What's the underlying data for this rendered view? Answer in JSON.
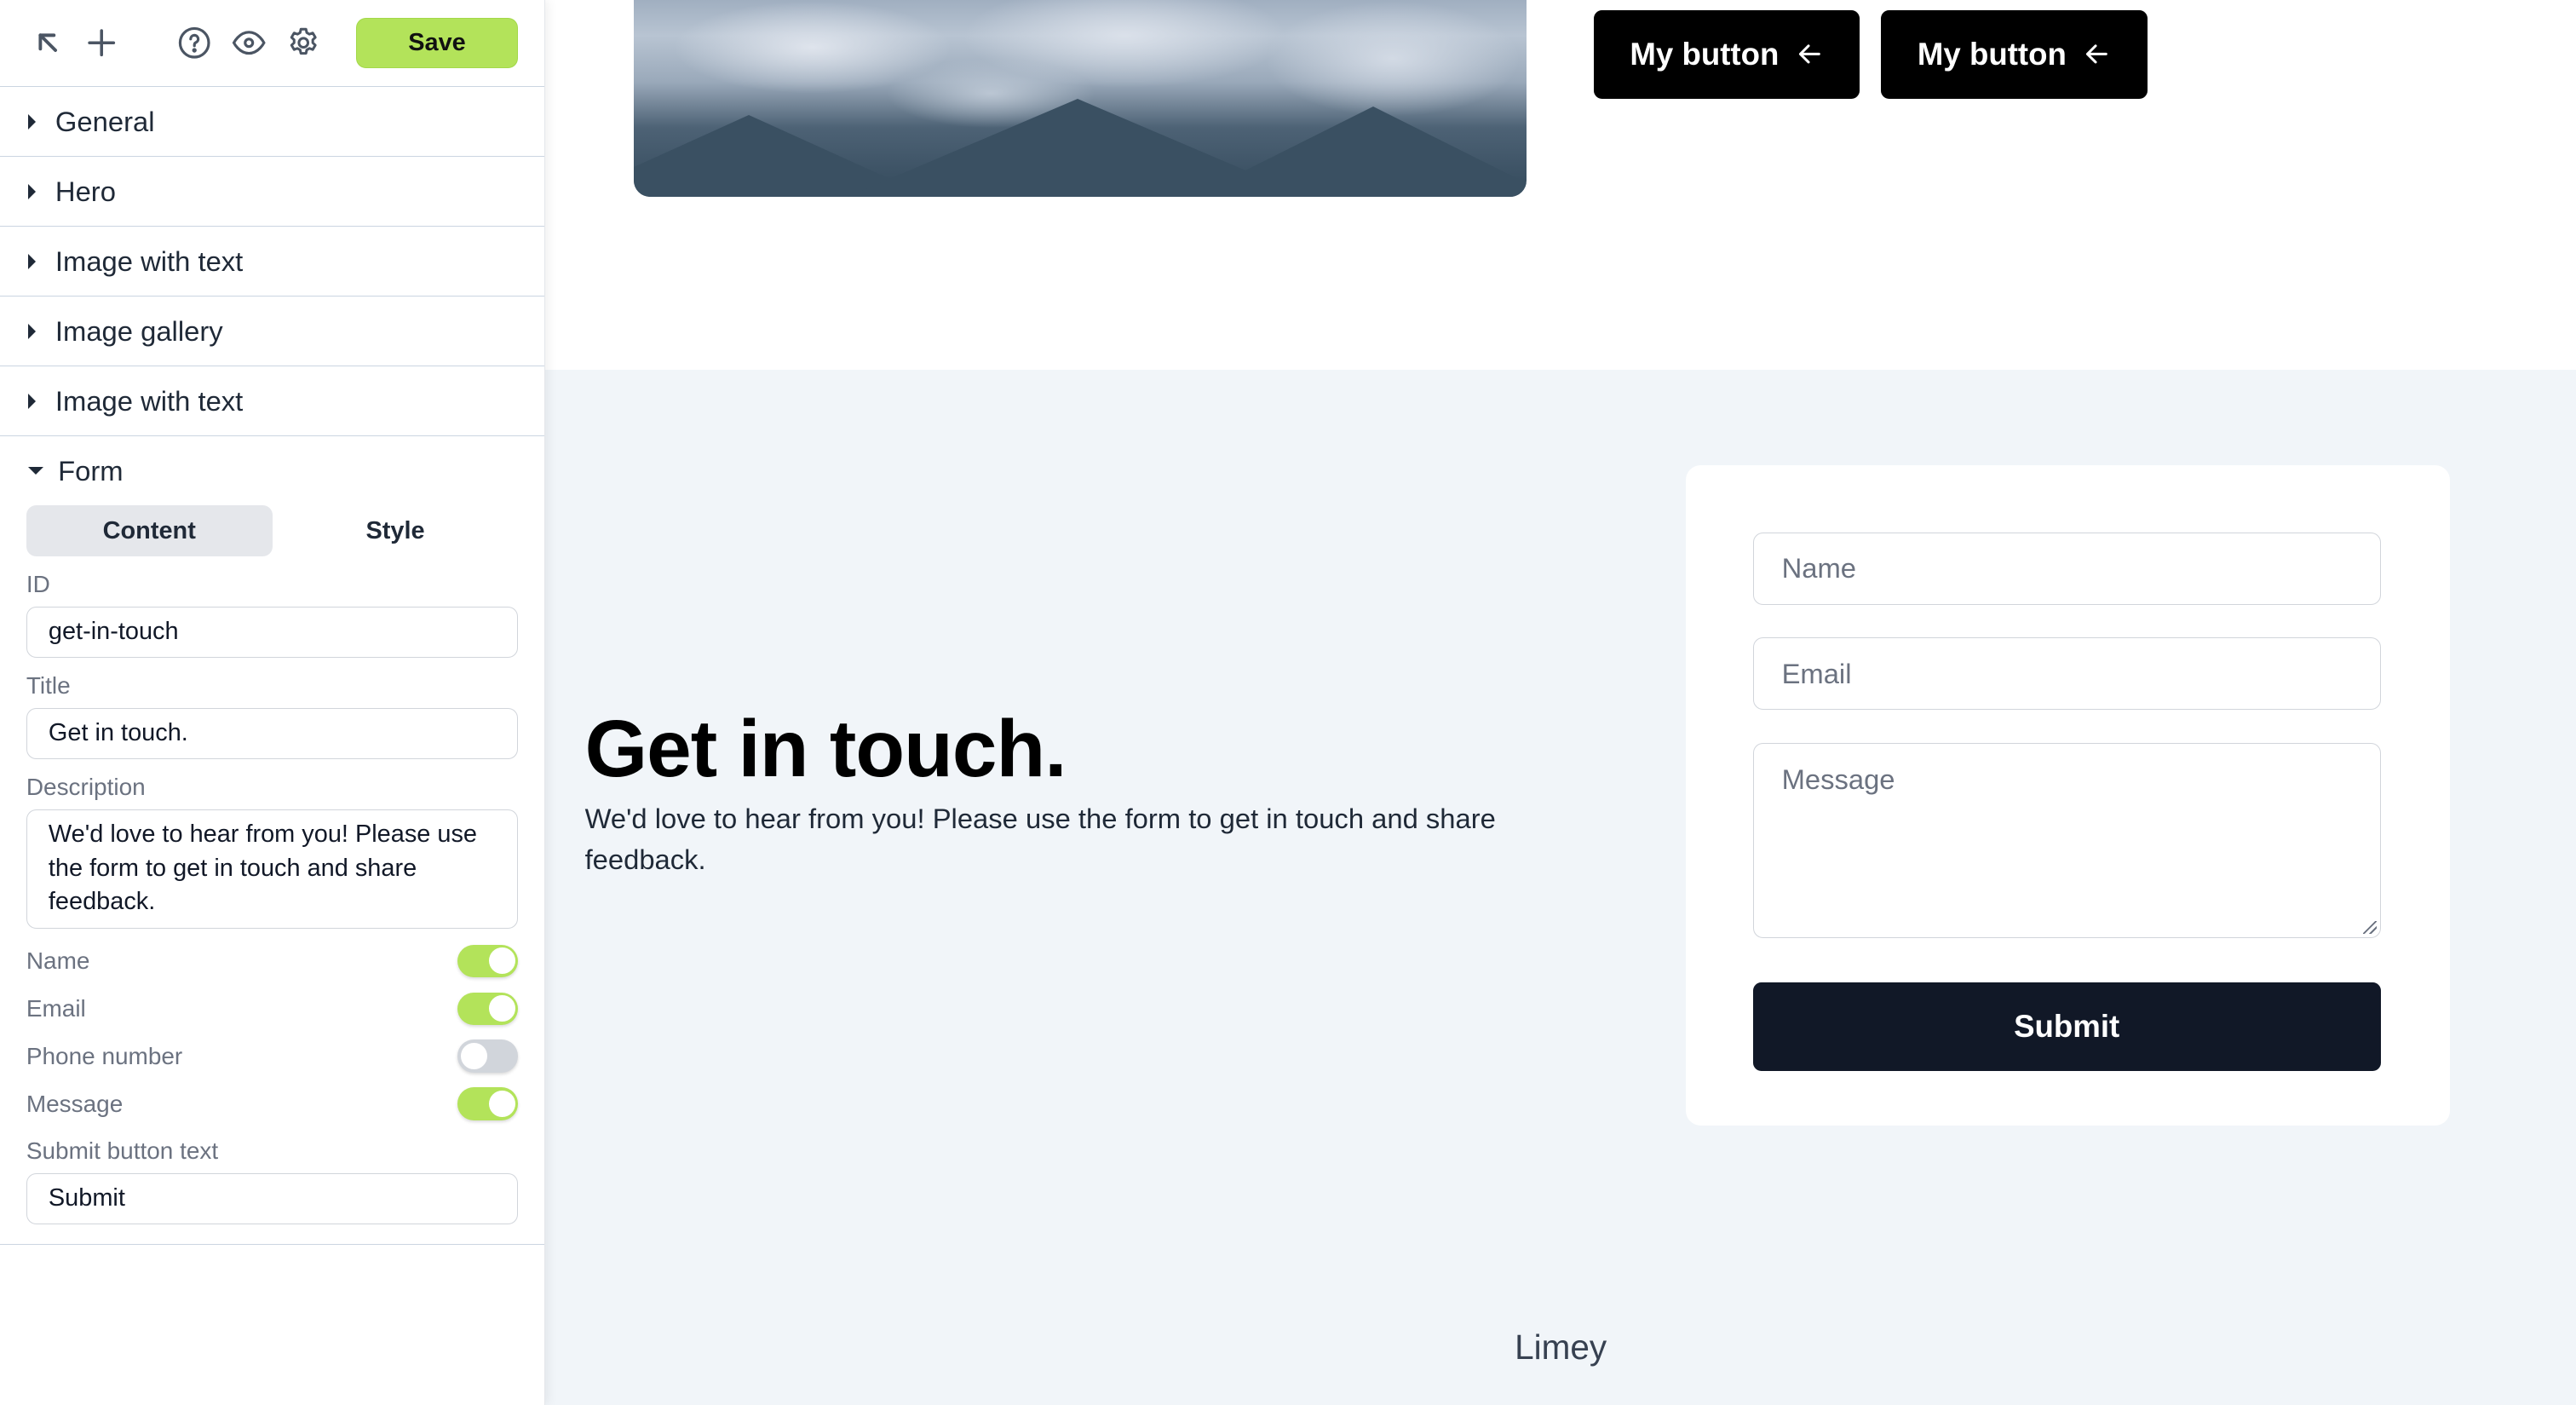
{
  "toolbar": {
    "icons": [
      "arrow-up-left-icon",
      "plus-icon",
      "help-icon",
      "eye-icon",
      "gear-icon"
    ],
    "save_label": "Save",
    "accent_color": "#b3e35a"
  },
  "sidebar": {
    "sections": [
      {
        "label": "General",
        "expanded": false
      },
      {
        "label": "Hero",
        "expanded": false
      },
      {
        "label": "Image with text",
        "expanded": false
      },
      {
        "label": "Image gallery",
        "expanded": false
      },
      {
        "label": "Image with text",
        "expanded": false
      },
      {
        "label": "Form",
        "expanded": true
      }
    ],
    "form": {
      "tabs": [
        {
          "label": "Content",
          "active": true
        },
        {
          "label": "Style",
          "active": false
        }
      ],
      "id_label": "ID",
      "id_value": "get-in-touch",
      "title_label": "Title",
      "title_value": "Get in touch.",
      "description_label": "Description",
      "description_value": "We'd love to hear from you! Please use the form to get in touch and share feedback.",
      "toggles": [
        {
          "label": "Name",
          "on": true
        },
        {
          "label": "Email",
          "on": true
        },
        {
          "label": "Phone number",
          "on": false
        },
        {
          "label": "Message",
          "on": true
        }
      ],
      "submit_label": "Submit button text",
      "submit_value": "Submit"
    }
  },
  "preview": {
    "buttons": [
      {
        "label": "My button",
        "icon": "arrow-left-icon"
      },
      {
        "label": "My button",
        "icon": "arrow-left-icon"
      }
    ],
    "contact": {
      "title": "Get in touch.",
      "description": "We'd love to hear from you! Please use the form to get in touch and share feedback.",
      "name_placeholder": "Name",
      "email_placeholder": "Email",
      "message_placeholder": "Message",
      "submit": "Submit"
    },
    "footer_brand": "Limey"
  }
}
